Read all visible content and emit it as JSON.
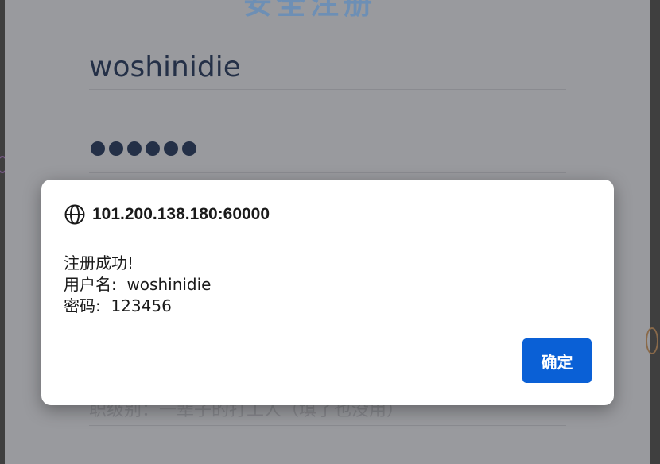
{
  "background_page": {
    "title": "安全注册",
    "username_value": "woshinidie",
    "password_mask_count": 6,
    "level_placeholder": "职级别：一辈子的打工人（填了也没用）"
  },
  "dialog": {
    "origin": "101.200.138.180:60000",
    "icon": "globe-icon",
    "message_lines": [
      "注册成功!",
      "用户名:  woshinidie",
      "密码:  123456"
    ],
    "ok_label": "确定"
  },
  "colors": {
    "accent_button": "#0a60d6",
    "dimmed_page": "#999a9e"
  }
}
